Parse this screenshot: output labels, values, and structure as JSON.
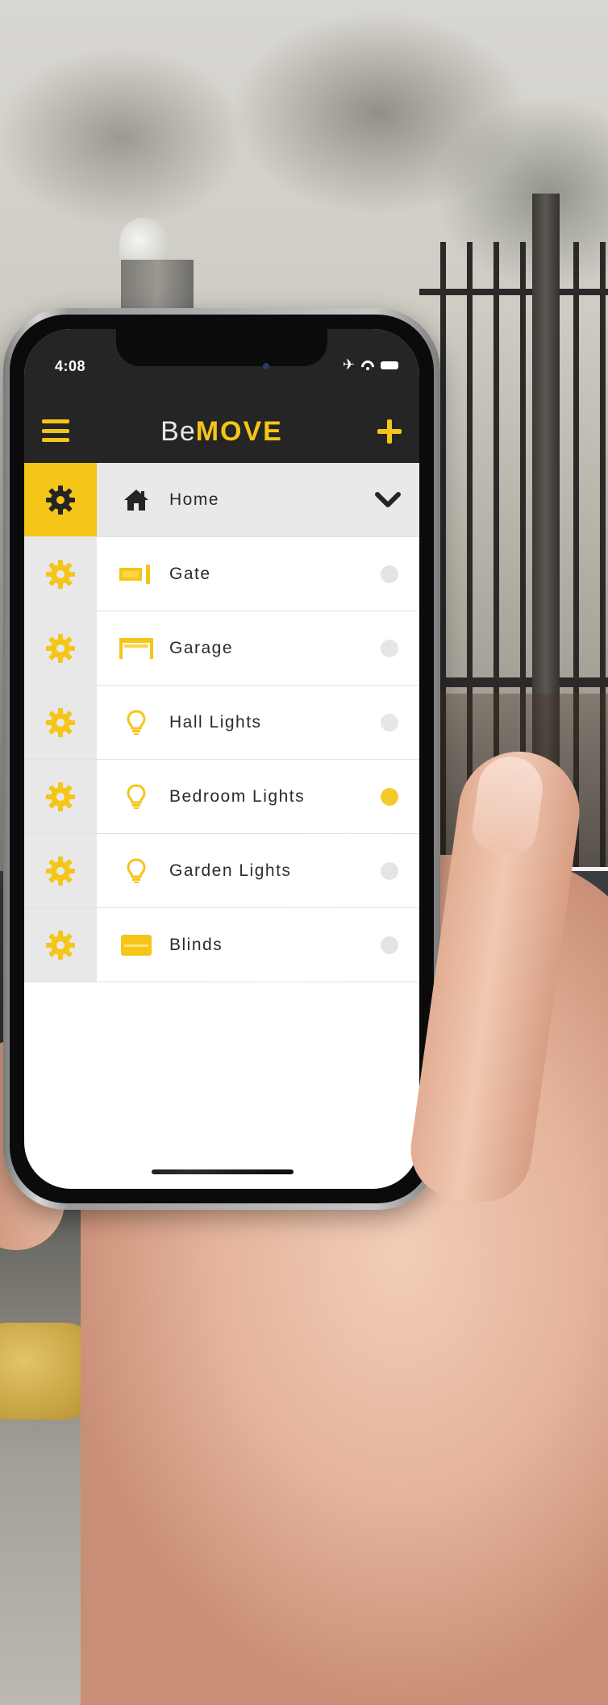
{
  "status_bar": {
    "time": "4:08"
  },
  "app": {
    "brand_light": "Be",
    "brand_bold": "MOVE",
    "accent_color": "#f5c518",
    "header_color": "#252525"
  },
  "list": {
    "header": {
      "label": "Home",
      "icon": "house-icon"
    },
    "items": [
      {
        "label": "Gate",
        "icon": "gate-icon",
        "on": false
      },
      {
        "label": "Garage",
        "icon": "garage-icon",
        "on": false
      },
      {
        "label": "Hall Lights",
        "icon": "lightbulb-icon",
        "on": false
      },
      {
        "label": "Bedroom Lights",
        "icon": "lightbulb-icon",
        "on": true
      },
      {
        "label": "Garden Lights",
        "icon": "lightbulb-icon",
        "on": false
      },
      {
        "label": "Blinds",
        "icon": "blinds-icon",
        "on": false
      }
    ]
  }
}
